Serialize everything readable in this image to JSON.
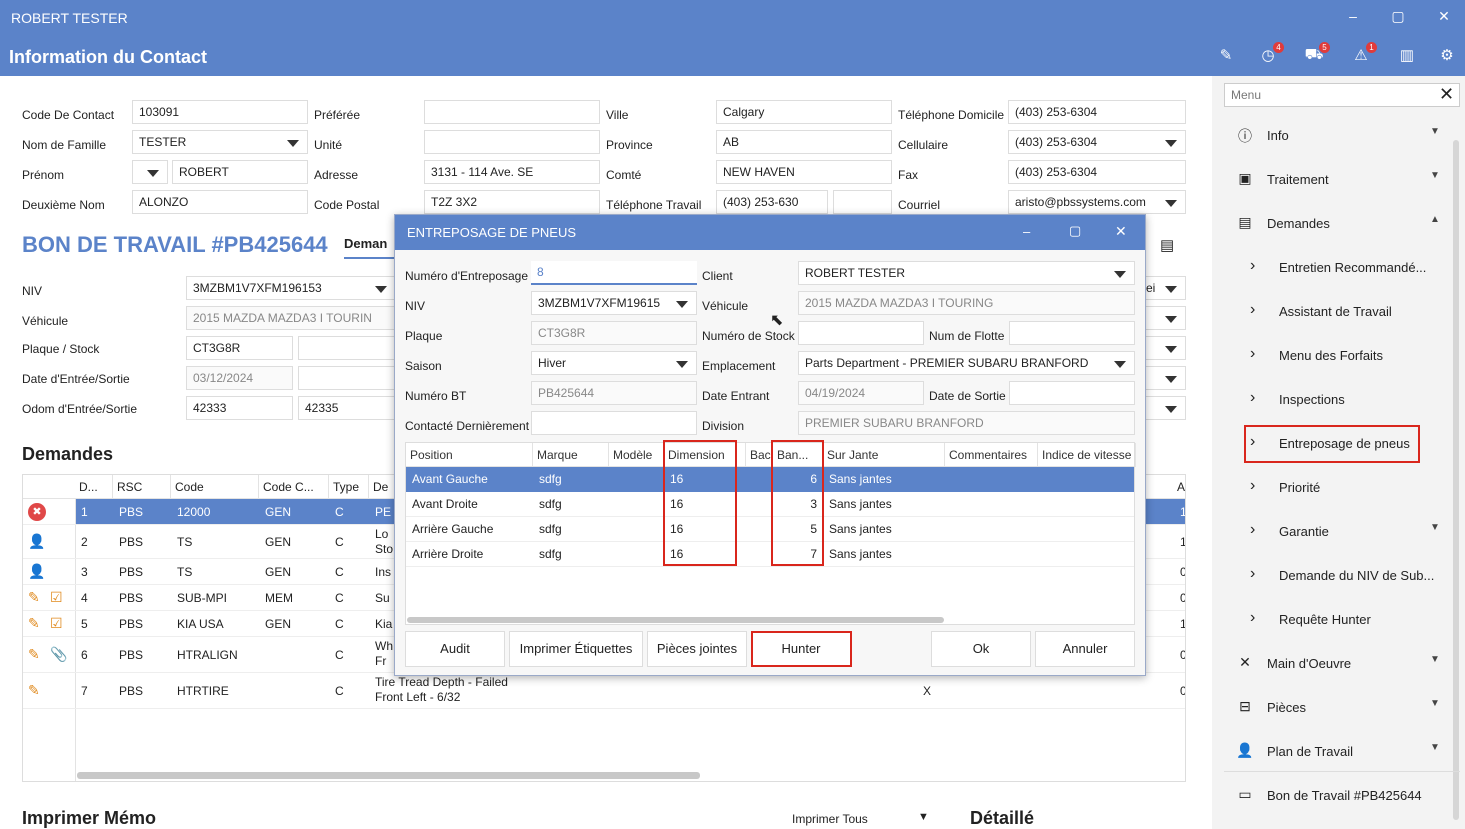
{
  "window": {
    "title": "ROBERT TESTER"
  },
  "header": {
    "title": "Information du Contact",
    "badges": {
      "history": "4",
      "car": "5",
      "alert": "1"
    }
  },
  "contact": {
    "code_label": "Code De Contact",
    "code": "103091",
    "nom_label": "Nom de Famille",
    "nom": "TESTER",
    "prenom_label": "Prénom",
    "prenom": "ROBERT",
    "deuxieme_label": "Deuxième Nom",
    "deuxieme": "ALONZO",
    "preferee_label": "Préférée",
    "unite_label": "Unité",
    "adresse_label": "Adresse",
    "adresse": "3131 - 114 Ave. SE",
    "postal_label": "Code Postal",
    "postal": "T2Z 3X2",
    "ville_label": "Ville",
    "ville": "Calgary",
    "province_label": "Province",
    "province": "AB",
    "comte_label": "Comté",
    "comte": "NEW HAVEN",
    "teltravail_label": "Téléphone Travail",
    "teltravail": "(403) 253-630",
    "teldom_label": "Téléphone Domicile",
    "teldom": "(403) 253-6304",
    "cell_label": "Cellulaire",
    "cell": "(403) 253-6304",
    "fax_label": "Fax",
    "fax": "(403) 253-6304",
    "courriel_label": "Courriel",
    "courriel": "aristo@pbssystems.com"
  },
  "bon": {
    "title": "BON DE TRAVAIL #PB425644",
    "tab": "Deman",
    "niv_label": "NIV",
    "niv": "3MZBM1V7XFM196153",
    "vehicule_label": "Véhicule",
    "vehicule": "2015 MAZDA MAZDA3 I TOURIN",
    "plaque_label": "Plaque / Stock",
    "plaque": "CT3G8R",
    "date_label": "Date d'Entrée/Sortie",
    "date": "03/12/2024",
    "odom_label": "Odom d'Entrée/Sortie",
    "odom_in": "42333",
    "odom_out": "42335",
    "right_frag": "ei"
  },
  "demandes": {
    "title": "Demandes",
    "headers": [
      "D...",
      "RSC",
      "Code",
      "Code C...",
      "Type",
      "De"
    ],
    "last_header": "A",
    "rows": [
      {
        "n": "1",
        "rsc": "PBS",
        "code": "12000",
        "cc": "GEN",
        "type": "C",
        "desc": "PE",
        "last": "1"
      },
      {
        "n": "2",
        "rsc": "PBS",
        "code": "TS",
        "cc": "GEN",
        "type": "C",
        "desc": "Lo\nSto",
        "last": "1"
      },
      {
        "n": "3",
        "rsc": "PBS",
        "code": "TS",
        "cc": "GEN",
        "type": "C",
        "desc": "Ins",
        "last": "0"
      },
      {
        "n": "4",
        "rsc": "PBS",
        "code": "SUB-MPI",
        "cc": "MEM",
        "type": "C",
        "desc": "Su",
        "last": "0"
      },
      {
        "n": "5",
        "rsc": "PBS",
        "code": "KIA USA",
        "cc": "GEN",
        "type": "C",
        "desc": "Kia",
        "last": "1"
      },
      {
        "n": "6",
        "rsc": "PBS",
        "code": "HTRALIGN",
        "cc": "",
        "type": "C",
        "desc": "Wh\nFr",
        "last": "0"
      },
      {
        "n": "7",
        "rsc": "PBS",
        "code": "HTRTIRE",
        "cc": "",
        "type": "C",
        "desc": "Tire Tread Depth - Failed\nFront Left - 6/32",
        "last": "0",
        "x": "X"
      }
    ]
  },
  "memo": {
    "title": "Imprimer Mémo",
    "print_all": "Imprimer Tous",
    "detail": "Détaillé"
  },
  "dialog": {
    "title": "ENTREPOSAGE DE PNEUS",
    "num_label": "Numéro d'Entreposage",
    "num": "8",
    "niv_label": "NIV",
    "niv": "3MZBM1V7XFM19615",
    "plaque_label": "Plaque",
    "plaque": "CT3G8R",
    "saison_label": "Saison",
    "saison": "Hiver",
    "bt_label": "Numéro BT",
    "bt": "PB425644",
    "contact_label": "Contacté Dernièrement",
    "contact": "",
    "client_label": "Client",
    "client": "ROBERT TESTER",
    "vehicule_label": "Véhicule",
    "vehicule": "2015 MAZDA MAZDA3 I TOURING",
    "stock_label": "Numéro de Stock",
    "stock": "",
    "flotte_label": "Num de Flotte",
    "flotte": "",
    "empl_label": "Emplacement",
    "empl": "Parts Department - PREMIER SUBARU BRANFORD",
    "entrant_label": "Date Entrant",
    "entrant": "04/19/2024",
    "sortie_label": "Date de Sortie",
    "sortie": "",
    "division_label": "Division",
    "division": "PREMIER SUBARU BRANFORD",
    "headers": [
      "Position",
      "Marque",
      "Modèle",
      "Dimension",
      "Bac",
      "Ban...",
      "Sur Jante",
      "Commentaires",
      "Indice de vitesse"
    ],
    "rows": [
      {
        "position": "Avant Gauche",
        "marque": "sdfg",
        "modele": "",
        "dimension": "16",
        "bac": "",
        "ban": "6",
        "jante": "Sans jantes"
      },
      {
        "position": "Avant Droite",
        "marque": "sdfg",
        "modele": "",
        "dimension": "16",
        "bac": "",
        "ban": "3",
        "jante": "Sans jantes"
      },
      {
        "position": "Arrière Gauche",
        "marque": "sdfg",
        "modele": "",
        "dimension": "16",
        "bac": "",
        "ban": "5",
        "jante": "Sans jantes"
      },
      {
        "position": "Arrière Droite",
        "marque": "sdfg",
        "modele": "",
        "dimension": "16",
        "bac": "",
        "ban": "7",
        "jante": "Sans jantes"
      }
    ],
    "buttons": {
      "audit": "Audit",
      "print": "Imprimer Étiquettes",
      "attach": "Pièces jointes",
      "hunter": "Hunter",
      "ok": "Ok",
      "cancel": "Annuler"
    }
  },
  "menu": {
    "placeholder": "Menu",
    "items": [
      {
        "label": "Info",
        "icon": "info-icon"
      },
      {
        "label": "Traitement",
        "icon": "process-icon"
      },
      {
        "label": "Demandes",
        "icon": "clipboard-icon"
      }
    ],
    "sub": [
      "Entretien Recommandé...",
      "Assistant de Travail",
      "Menu des Forfaits",
      "Inspections",
      "Entreposage de pneus",
      "Priorité",
      "Garantie",
      "Demande du NIV de Sub...",
      "Requête Hunter"
    ],
    "items2": [
      {
        "label": "Main d'Oeuvre",
        "icon": "tools-icon"
      },
      {
        "label": "Pièces",
        "icon": "parts-icon"
      },
      {
        "label": "Plan de Travail",
        "icon": "person-icon"
      },
      {
        "label": "Bon de Travail #PB425644",
        "icon": "folder-icon"
      }
    ]
  },
  "colors": {
    "accent": "#5b83c9",
    "highlight": "#d9261c"
  }
}
